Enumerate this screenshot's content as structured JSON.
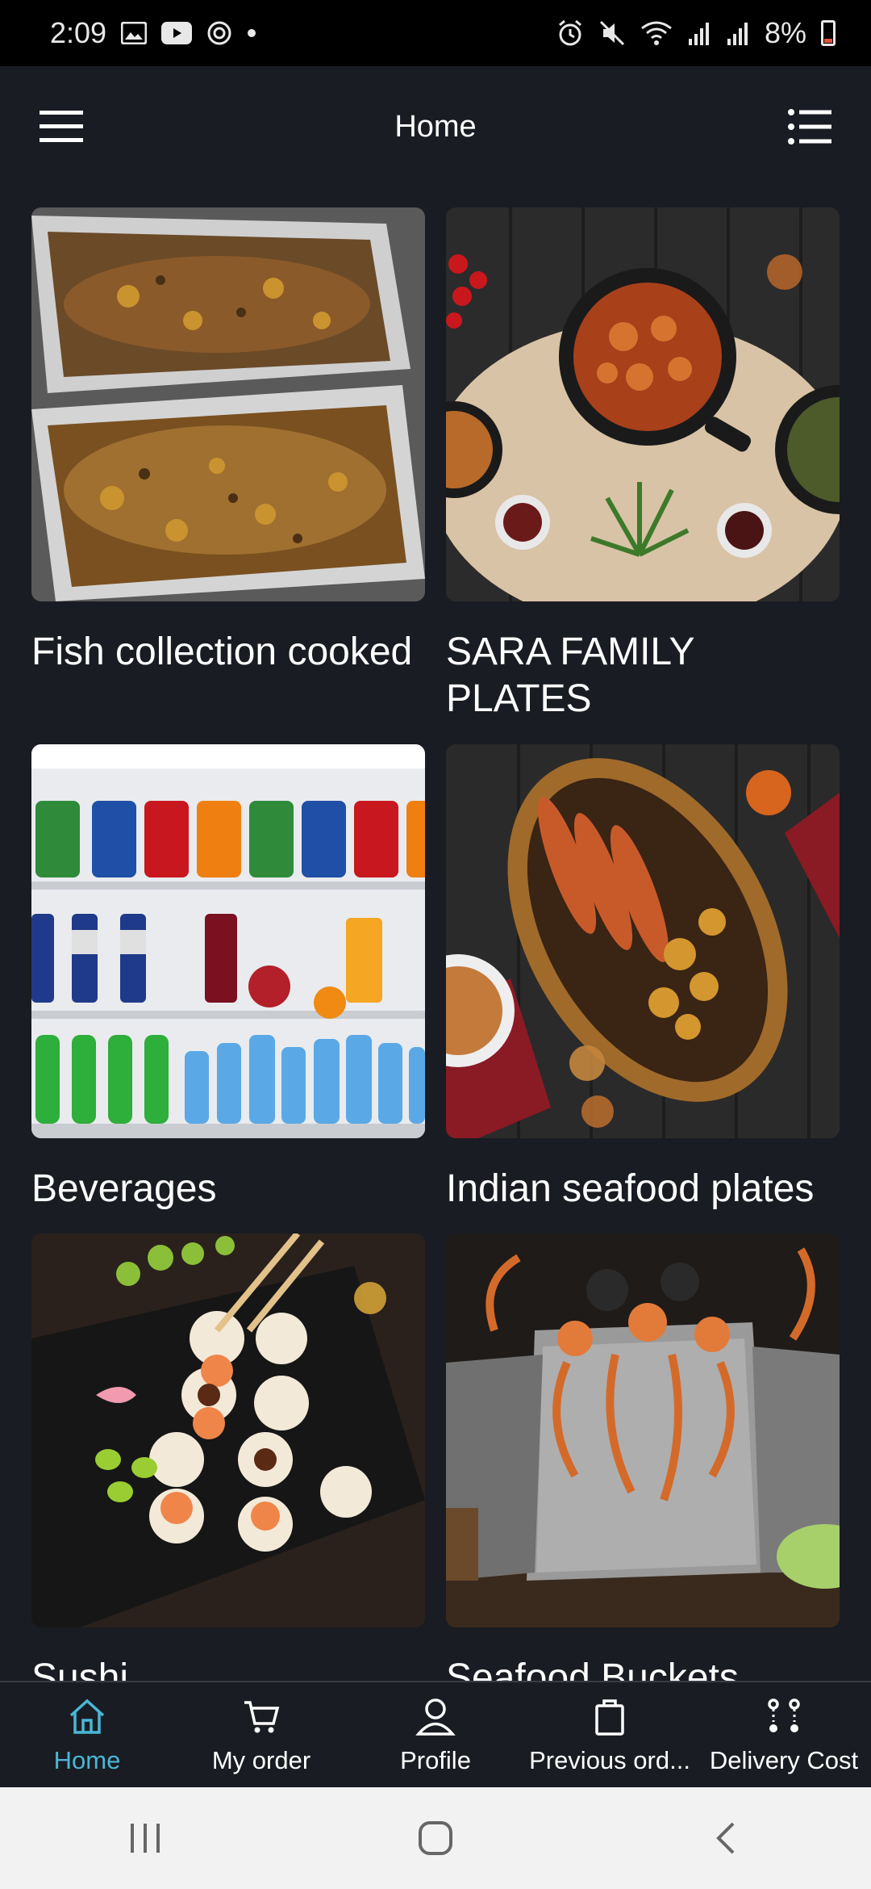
{
  "status_bar": {
    "time": "2:09",
    "battery": "8%"
  },
  "app_bar": {
    "title": "Home",
    "menu_icon": "hamburger-menu-icon",
    "list_icon": "list-view-icon"
  },
  "categories": [
    {
      "label": "Fish collection cooked"
    },
    {
      "label": "SARA FAMILY PLATES"
    },
    {
      "label": "Beverages"
    },
    {
      "label": "Indian seafood plates"
    },
    {
      "label": "Sushi"
    },
    {
      "label": "Seafood Buckets"
    }
  ],
  "bottom_nav": {
    "items": [
      {
        "label": "Home",
        "icon": "home-icon",
        "active": true
      },
      {
        "label": "My order",
        "icon": "cart-icon"
      },
      {
        "label": "Profile",
        "icon": "profile-icon"
      },
      {
        "label": "Previous ord...",
        "icon": "bag-icon"
      },
      {
        "label": "Delivery Cost",
        "icon": "route-icon"
      }
    ]
  },
  "colors": {
    "background": "#191c22",
    "accent": "#4ab6d6"
  }
}
